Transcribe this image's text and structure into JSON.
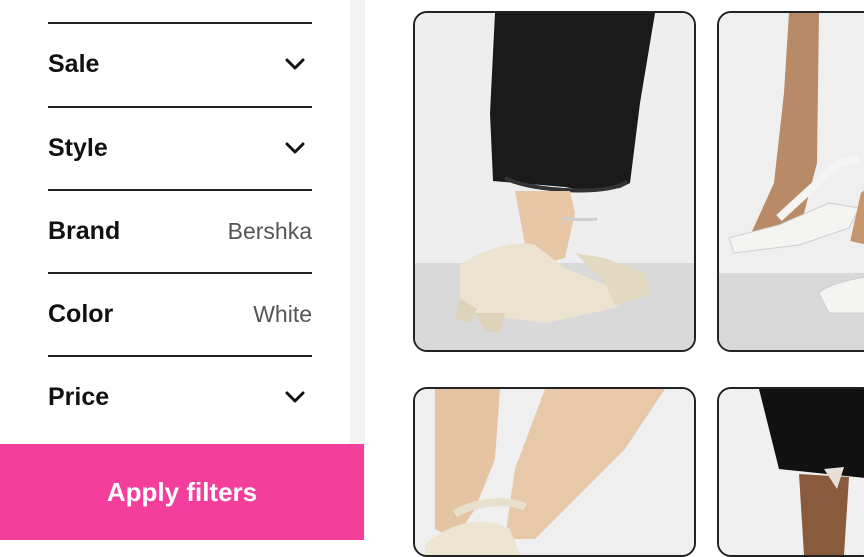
{
  "filters": {
    "sale": {
      "label": "Sale"
    },
    "style": {
      "label": "Style"
    },
    "brand": {
      "label": "Brand",
      "value": "Bershka"
    },
    "color": {
      "label": "Color",
      "value": "White"
    },
    "price": {
      "label": "Price"
    }
  },
  "apply_button": {
    "label": "Apply filters"
  },
  "colors": {
    "accent": "#f33e9c",
    "divider": "#222222",
    "gutter": "#f3f3f5"
  },
  "icons": {
    "expand": "chevron-down-icon"
  },
  "products": [
    {
      "image": "cream-platform-mule-photo"
    },
    {
      "image": "white-strappy-heel-photo"
    },
    {
      "image": "cream-ankle-strap-heel-photo"
    },
    {
      "image": "black-dress-legs-photo"
    }
  ]
}
